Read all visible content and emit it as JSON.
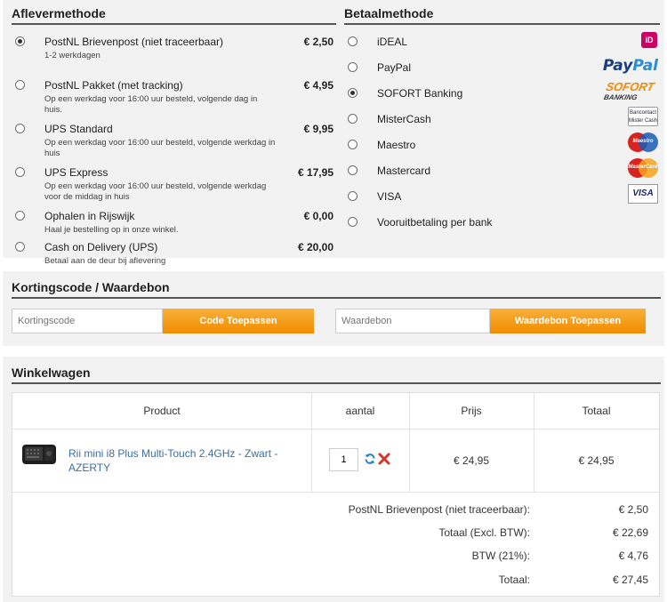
{
  "shipping": {
    "title": "Aflevermethode",
    "options": [
      {
        "name": "PostNL Brievenpost (niet traceerbaar)",
        "desc": "1-2 werkdagen",
        "price": "€ 2,50",
        "selected": true
      },
      {
        "name": "PostNL Pakket (met tracking)",
        "desc": "Op een werkdag voor 16:00 uur besteld, volgende dag in huis.",
        "price": "€ 4,95",
        "selected": false
      },
      {
        "name": "UPS Standard",
        "desc": "Op een werkdag voor 16:00 uur besteld, volgende werkdag in huis",
        "price": "€ 9,95",
        "selected": false
      },
      {
        "name": "UPS Express",
        "desc": "Op een werkdag voor 16:00 uur besteld, volgende werkdag voor de middag in huis",
        "price": "€ 17,95",
        "selected": false
      },
      {
        "name": "Ophalen in Rijswijk",
        "desc": "Haal je bestelling op in onze winkel.",
        "price": "€ 0,00",
        "selected": false
      },
      {
        "name": "Cash on Delivery (UPS)",
        "desc": "Betaal aan de deur bij aflevering",
        "price": "€ 20,00",
        "selected": false
      }
    ]
  },
  "payment": {
    "title": "Betaalmethode",
    "options": [
      {
        "name": "iDEAL",
        "logo": "ideal-logo",
        "selected": false
      },
      {
        "name": "PayPal",
        "logo": "paypal-logo",
        "selected": false
      },
      {
        "name": "SOFORT Banking",
        "logo": "sofort-logo",
        "selected": true
      },
      {
        "name": "MisterCash",
        "logo": "bancontact-logo",
        "selected": false
      },
      {
        "name": "Maestro",
        "logo": "maestro-logo",
        "selected": false
      },
      {
        "name": "Mastercard",
        "logo": "mastercard-logo",
        "selected": false
      },
      {
        "name": "VISA",
        "logo": "visa-logo",
        "selected": false
      },
      {
        "name": "Vooruitbetaling per bank",
        "logo": "",
        "selected": false
      }
    ],
    "logo_text": {
      "paypal_a": "Pay",
      "paypal_b": "Pal",
      "sofort_a": "SOFORT",
      "sofort_b": "BANKING",
      "bancontact_a": "Bancontact",
      "bancontact_b": "Mister Cash",
      "maestro": "Maestro",
      "mastercard": "MasterCard",
      "visa": "VISA"
    }
  },
  "discount": {
    "title": "Kortingscode / Waardebon",
    "code_placeholder": "Kortingscode",
    "code_button": "Code Toepassen",
    "voucher_placeholder": "Waardebon",
    "voucher_button": "Waardebon Toepassen"
  },
  "cart": {
    "title": "Winkelwagen",
    "headers": {
      "product": "Product",
      "qty": "aantal",
      "price": "Prijs",
      "total": "Totaal"
    },
    "item": {
      "name": "Rii mini i8 Plus Multi-Touch 2.4GHz - Zwart - AZERTY",
      "qty": "1",
      "price": "€ 24,95",
      "total": "€ 24,95"
    },
    "summary": [
      {
        "label": "PostNL Brievenpost (niet traceerbaar):",
        "value": "€ 2,50"
      },
      {
        "label": "Totaal (Excl. BTW):",
        "value": "€ 22,69"
      },
      {
        "label": "BTW (21%):",
        "value": "€ 4,76"
      },
      {
        "label": "Totaal:",
        "value": "€ 27,45"
      }
    ]
  },
  "colors": {
    "accent_orange": "#f08c00",
    "link_blue": "#3a6ea5",
    "panel_bg": "#f2f2f2"
  }
}
